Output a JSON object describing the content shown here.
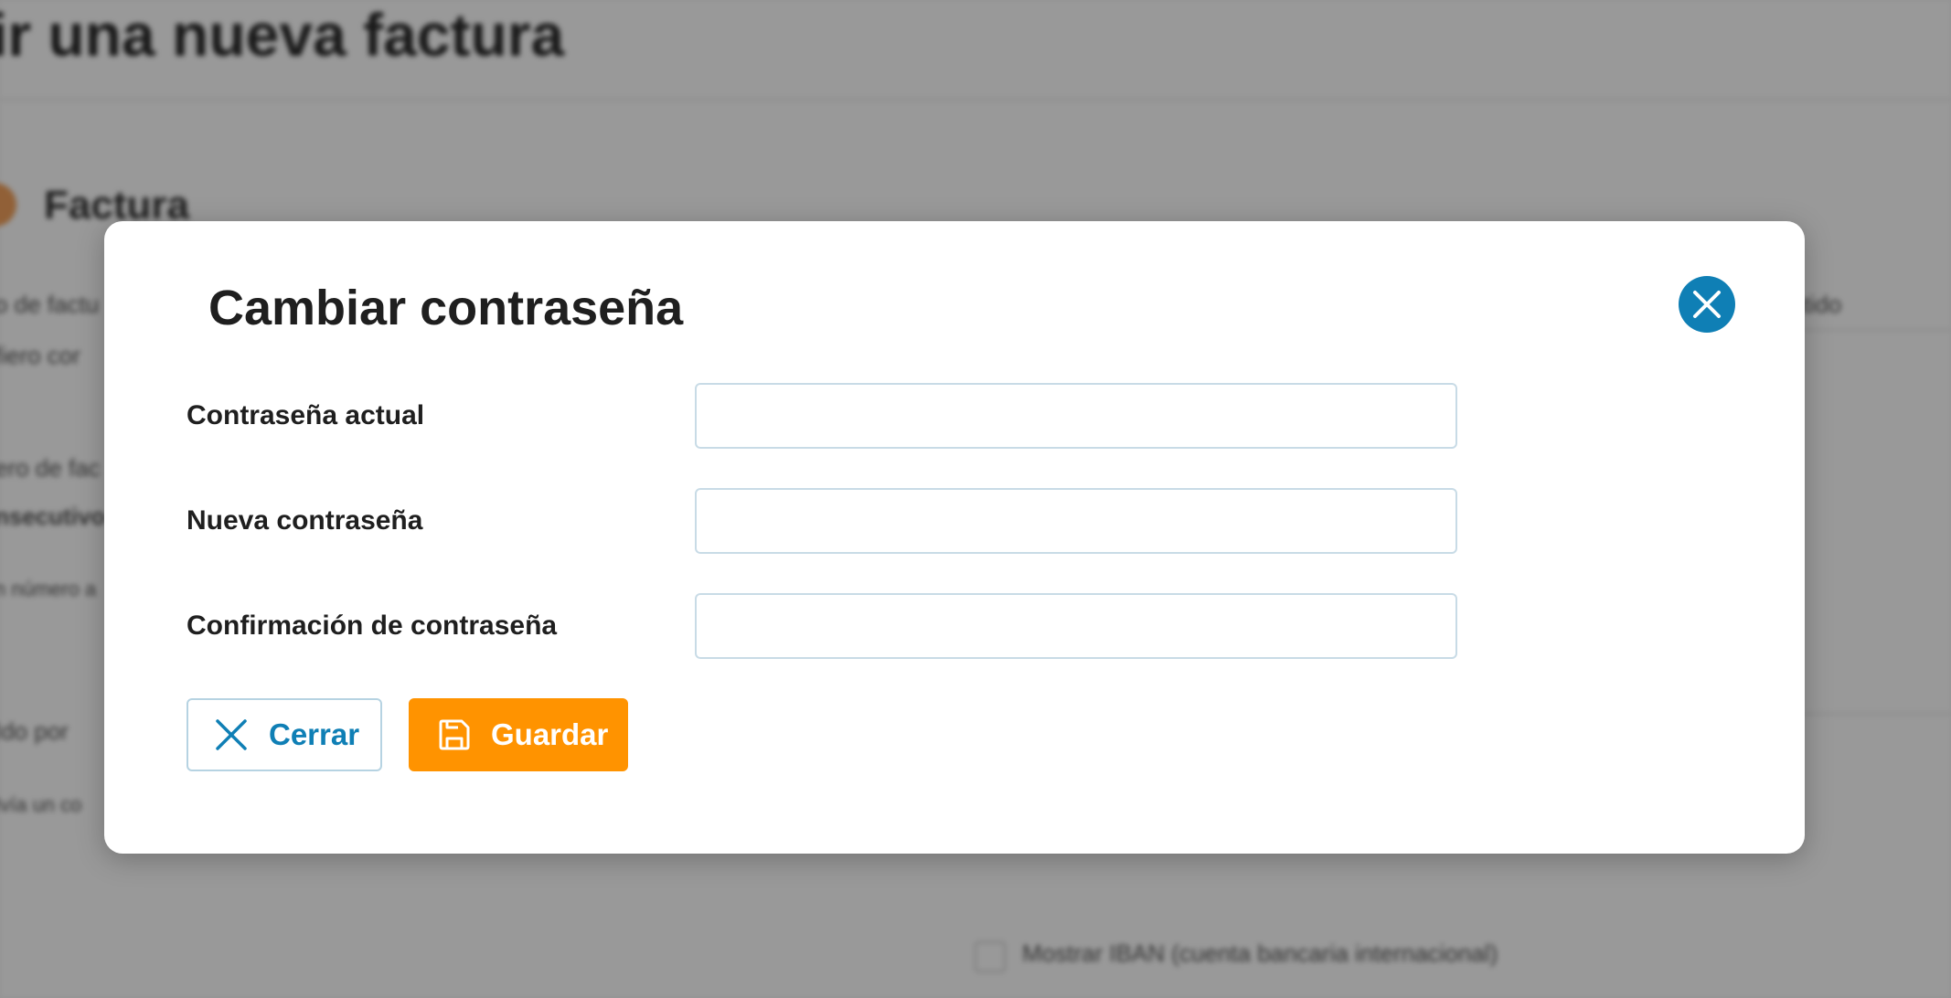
{
  "background": {
    "page_title": "ir una nueva factura",
    "section_title": "Factura",
    "snippets": [
      "o de factu",
      "fiero cor",
      "ero de fac",
      "nsecutivo",
      "n número a",
      "Ido por",
      "Ivía un co",
      "ntido",
      "Mostrar IBAN (cuenta bancaria internacional)"
    ]
  },
  "modal": {
    "title": "Cambiar contraseña",
    "close_icon": "close-icon",
    "fields": [
      {
        "label": "Contraseña actual",
        "value": "",
        "placeholder": ""
      },
      {
        "label": "Nueva contraseña",
        "value": "",
        "placeholder": ""
      },
      {
        "label": "Confirmación de contraseña",
        "value": "",
        "placeholder": ""
      }
    ],
    "buttons": {
      "cancel_label": "Cerrar",
      "cancel_icon": "close-icon",
      "save_label": "Guardar",
      "save_icon": "floppy-disk-icon"
    }
  },
  "colors": {
    "accent_blue": "#0f7fb5",
    "save_orange": "#ff9300",
    "overlay": "rgba(0,0,0,0.4)"
  }
}
